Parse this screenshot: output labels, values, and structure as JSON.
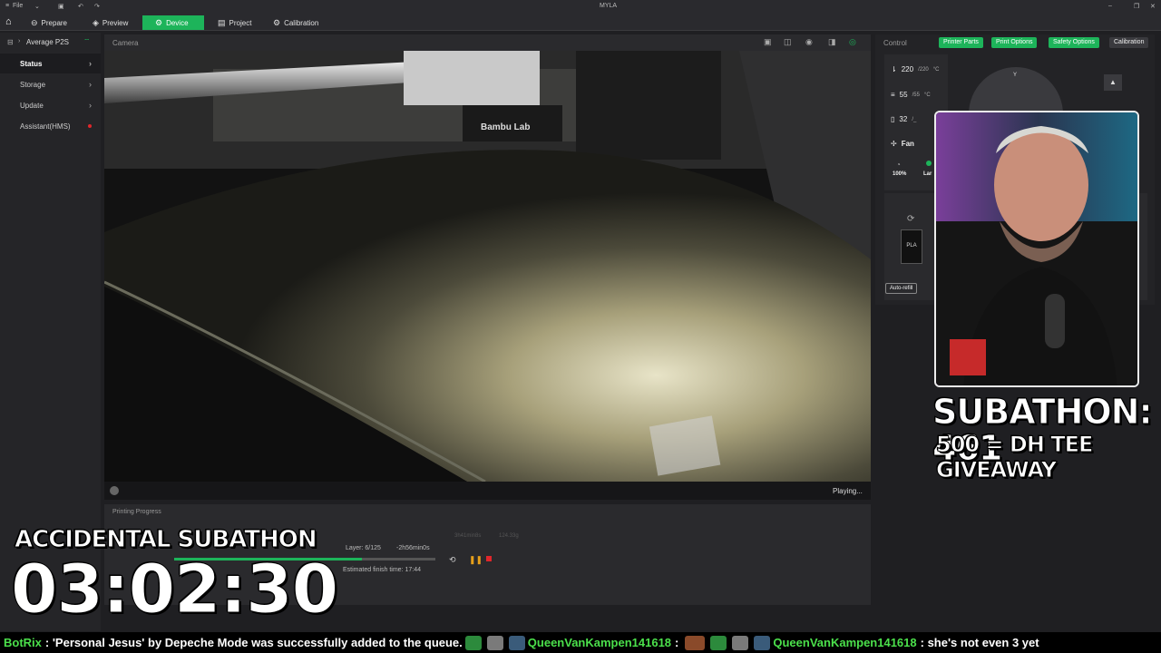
{
  "titlebar": {
    "file_label": "File",
    "app_title": "MYLA"
  },
  "tabs": [
    {
      "label": "Prepare",
      "icon": "home-icon"
    },
    {
      "label": "Preview",
      "icon": "eye-icon"
    },
    {
      "label": "Device",
      "icon": "device-icon",
      "active": true
    },
    {
      "label": "Project",
      "icon": "project-icon"
    },
    {
      "label": "Calibration",
      "icon": "calibration-icon"
    }
  ],
  "sidebar": {
    "printer_name": "Average P2S",
    "items": [
      {
        "label": "Status"
      },
      {
        "label": "Storage"
      },
      {
        "label": "Update"
      },
      {
        "label": "Assistant(HMS)"
      }
    ]
  },
  "camera": {
    "title": "Camera",
    "status": "Playing..."
  },
  "progress": {
    "title": "Printing Progress",
    "layer": "Layer: 6/125",
    "remaining": "-2h56min0s",
    "finish": "Estimated finish time: 17:44",
    "faint_time": "3h41min8s",
    "faint_weight": "124.33g",
    "fraction": 0.72
  },
  "control": {
    "title": "Control",
    "buttons": [
      "Printer Parts",
      "Print Options",
      "Safety Options",
      "Calibration"
    ],
    "nozzle": {
      "value": "220",
      "target": "/220",
      "unit": "°C"
    },
    "bed": {
      "value": "55",
      "target": "/55",
      "unit": "°C"
    },
    "chamber": {
      "value": "32",
      "target": "/_"
    },
    "fan_label": "Fan",
    "fan_percent": "100%",
    "lamp_label": "Lar",
    "filament": "PLA",
    "auto_refill": "Auto-refill",
    "y_label": "Y"
  },
  "overlay": {
    "subathon": "SUBATHON: 461",
    "giveaway": "500 = DH TEE GIVEAWAY",
    "accidental": "ACCIDENTAL SUBATHON",
    "timer": "03:02:30"
  },
  "ticker": {
    "bot": "BotRix",
    "message": ": 'Personal Jesus' by Depeche Mode was successfully added to the queue.",
    "user1": "QueenVanKampen141618",
    "sep1": ":",
    "user2": "QueenVanKampen141618",
    "message2": ": she's not even 3 yet"
  },
  "colors": {
    "accent": "#1db45a",
    "stop": "#e0262b",
    "pause": "#e7a01a"
  }
}
